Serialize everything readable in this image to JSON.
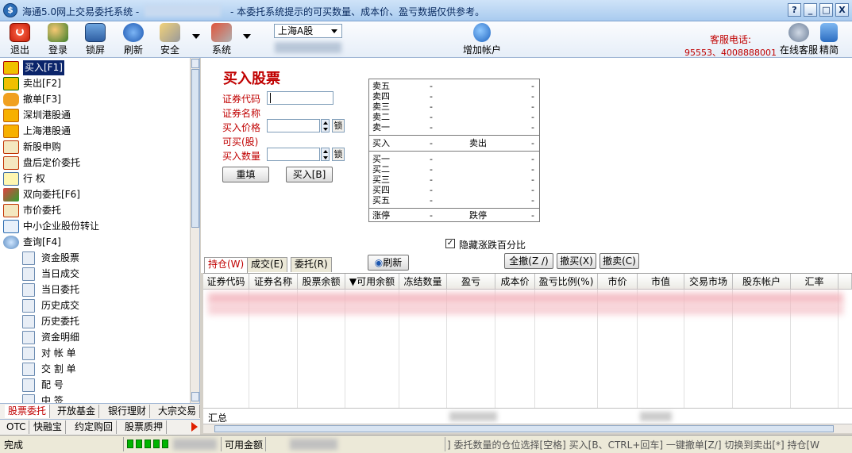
{
  "window": {
    "title": "海通5.0网上交易委托系统 -",
    "notice": "- 本委托系统提示的可买数量、成本价、盈亏数据仅供参考。",
    "controls": [
      "?",
      "_",
      "□",
      "X"
    ]
  },
  "toolbar": {
    "items": [
      {
        "label": "退出",
        "icon": "power-icon"
      },
      {
        "label": "登录",
        "icon": "users-icon"
      },
      {
        "label": "锁屏",
        "icon": "lock-screen-icon"
      },
      {
        "label": "刷新",
        "icon": "refresh-icon"
      },
      {
        "label": "安全",
        "icon": "key-icon"
      },
      {
        "label": "系统",
        "icon": "tools-icon"
      }
    ],
    "market_select": "上海A股",
    "add_account": "增加帐户",
    "service_label": "客服电话:",
    "service_phone": "95553、4008888001",
    "online_service": "在线客服",
    "simplified": "精简"
  },
  "nav": {
    "items": [
      {
        "label": "买入[F1]",
        "icon": "buy-icon",
        "selected": true
      },
      {
        "label": "卖出[F2]",
        "icon": "sell-icon"
      },
      {
        "label": "撤单[F3]",
        "icon": "cancel-hand-icon"
      },
      {
        "label": "深圳港股通",
        "icon": "sz-hk-connect-icon"
      },
      {
        "label": "上海港股通",
        "icon": "sh-hk-connect-icon"
      },
      {
        "label": "新股申购",
        "icon": "ipo-icon"
      },
      {
        "label": "盘后定价委托",
        "icon": "after-hours-icon"
      },
      {
        "label": "行    权",
        "icon": "exercise-icon"
      },
      {
        "label": "双向委托[F6]",
        "icon": "two-way-icon"
      },
      {
        "label": "市价委托",
        "icon": "market-order-icon"
      },
      {
        "label": "中小企业股份转让",
        "icon": "sme-transfer-icon"
      },
      {
        "label": "查询[F4]",
        "icon": "query-icon"
      }
    ],
    "sub_items": [
      "资金股票",
      "当日成交",
      "当日委托",
      "历史成交",
      "历史委托",
      "资金明细",
      "对 帐 单",
      "交 割 单",
      "配    号",
      "中    签"
    ],
    "tabs_row1": [
      "股票委托",
      "开放基金",
      "银行理财",
      "大宗交易"
    ],
    "tabs_row2": [
      "OTC",
      "快融宝",
      "约定购回",
      "股票质押"
    ]
  },
  "form": {
    "title": "买入股票",
    "code_label": "证券代码",
    "name_label": "证券名称",
    "price_label": "买入价格",
    "buyable_label": "可买(股)",
    "qty_label": "买入数量",
    "lock": "锁",
    "reset_button": "重填",
    "buy_button": "买入[B]"
  },
  "quote": {
    "sells": [
      "卖五",
      "卖四",
      "卖三",
      "卖二",
      "卖一"
    ],
    "buys": [
      "买一",
      "买二",
      "买三",
      "买四",
      "买五"
    ],
    "mid_left": "买入",
    "mid_right": "卖出",
    "limit_up": "涨停",
    "limit_down": "跌停",
    "dash": "-"
  },
  "hide_pct": {
    "label": "隐藏涨跌百分比",
    "checked": true
  },
  "positions": {
    "tabs": [
      "持仓(W)",
      "成交(E)",
      "委托(R)"
    ],
    "refresh": "刷新",
    "cancel_all": "全撤(Z /)",
    "cancel_buy": "撤买(X)",
    "cancel_sell": "撤卖(C)",
    "columns": [
      "证券代码",
      "证券名称",
      "股票余额",
      "▼可用余额",
      "冻结数量",
      "盈亏",
      "成本价",
      "盈亏比例(%)",
      "市价",
      "市值",
      "交易市场",
      "股东帐户",
      "汇率"
    ],
    "summary_label": "汇总"
  },
  "statusbar": {
    "state": "完成",
    "available": "可用金额",
    "help": "] 委托数量的仓位选择[空格] 买入[B、CTRL+回车] 一键撤单[Z/] 切换到卖出[*] 持仓[W"
  },
  "colors": {
    "accent_red": "#c00000",
    "selected_bg": "#0a246a",
    "title_bar": "#a9cbef"
  }
}
